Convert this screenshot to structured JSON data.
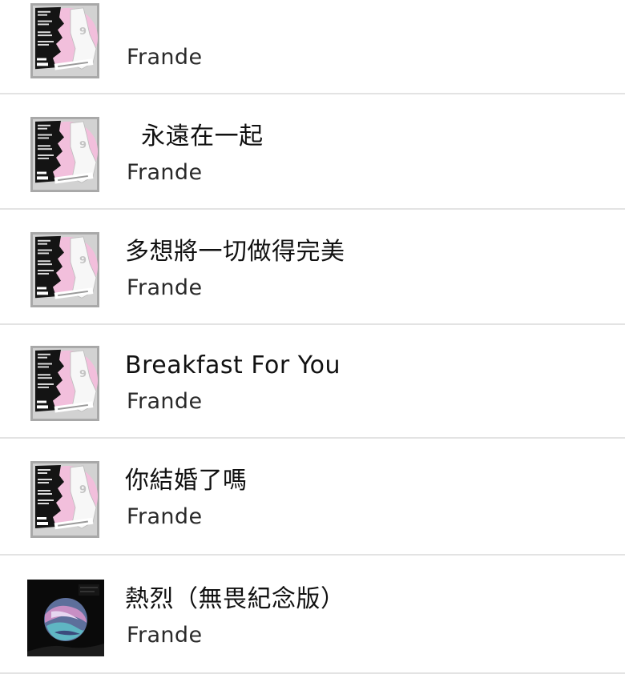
{
  "songs": [
    {
      "title": "",
      "artist": "Frande",
      "artwork": "evidence-album-cover"
    },
    {
      "title": "  永遠在一起",
      "artist": "Frande",
      "artwork": "evidence-album-cover"
    },
    {
      "title": "多想將一切做得完美",
      "artist": "Frande",
      "artwork": "evidence-album-cover"
    },
    {
      "title": "Breakfast For You",
      "artist": "Frande",
      "artwork": "evidence-album-cover"
    },
    {
      "title": "你結婚了嗎",
      "artist": "Frande",
      "artwork": "evidence-album-cover"
    },
    {
      "title": "熱烈（無畏紀念版）",
      "artist": "Frande",
      "artwork": "planet-album-cover"
    }
  ],
  "colors": {
    "divider": "#e3e3e3",
    "cover_pink": "#f2bfdc",
    "cover_gray": "#a8a8a8",
    "cover_dark": "#0a0a0a"
  }
}
